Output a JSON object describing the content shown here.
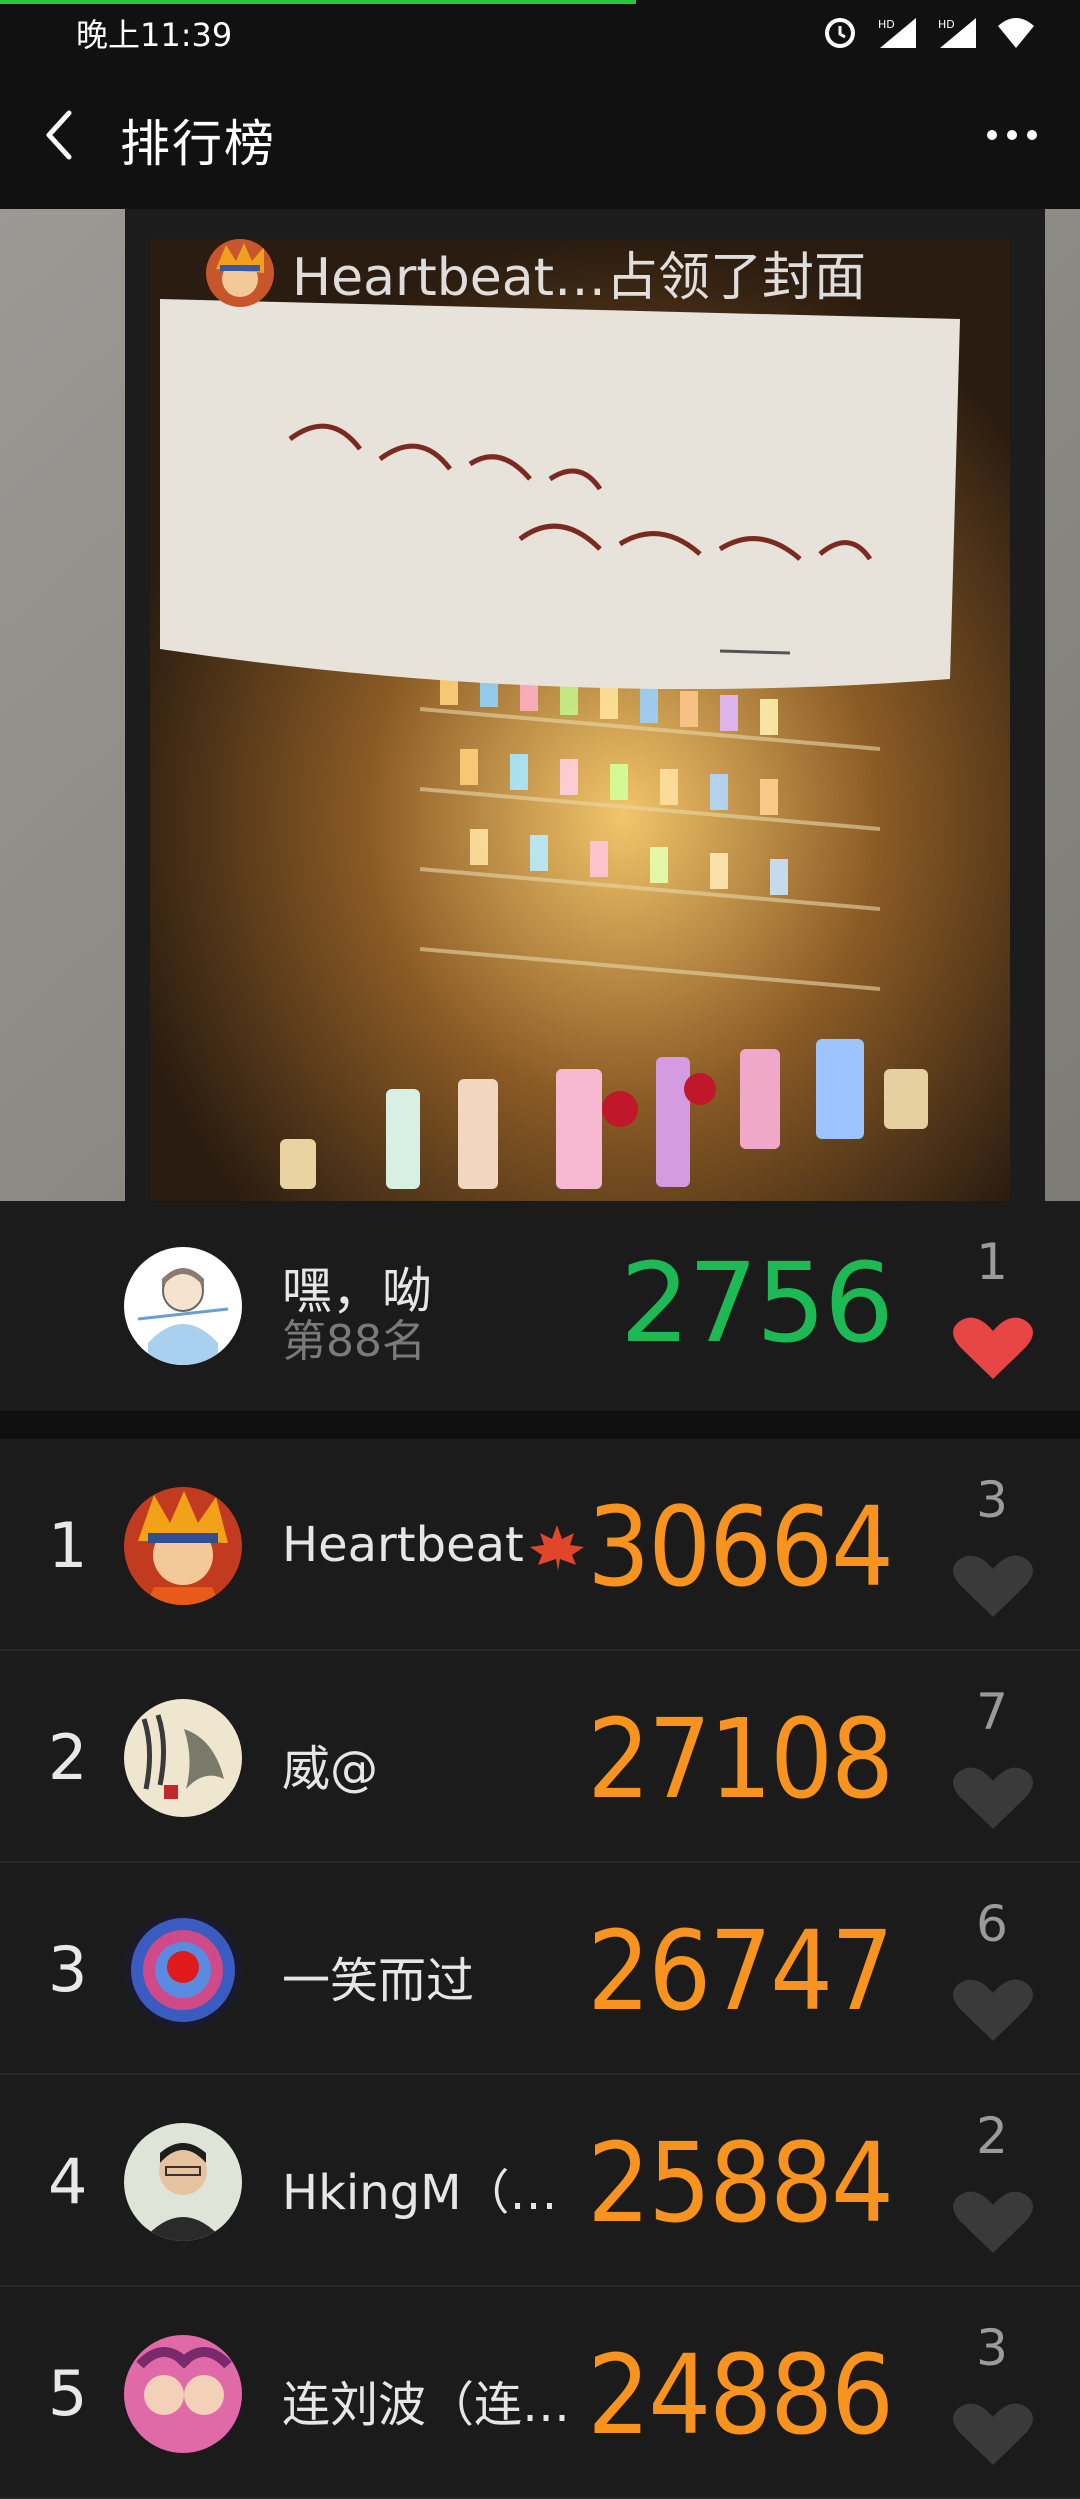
{
  "status_bar": {
    "time": "晚上11:39"
  },
  "header": {
    "title": "排行榜"
  },
  "cover": {
    "owner_text": "Heartbeat…占领了封面"
  },
  "my_rank": {
    "name": "嘿，呦",
    "place": "第88名",
    "score": "2756",
    "likes": "1"
  },
  "rankings": [
    {
      "rank": "1",
      "name": "Heartbeat",
      "score": "30664",
      "likes": "3"
    },
    {
      "rank": "2",
      "name": "威@",
      "score": "27108",
      "likes": "7"
    },
    {
      "rank": "3",
      "name": "一笑而过",
      "score": "26747",
      "likes": "6"
    },
    {
      "rank": "4",
      "name": "HkingM（…",
      "score": "25884",
      "likes": "2"
    },
    {
      "rank": "5",
      "name": "连刘波（连…",
      "score": "24886",
      "likes": "3"
    }
  ],
  "colors": {
    "score_orange": "#f7931e",
    "my_score_green": "#1db954",
    "liked_heart": "#e84545",
    "unliked_heart": "#3a3a3a"
  }
}
